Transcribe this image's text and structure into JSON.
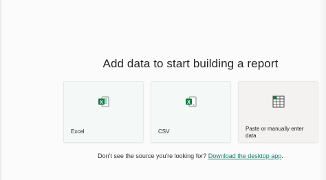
{
  "heading": "Add data to start building a report",
  "cards": [
    {
      "label": "Excel",
      "icon": "excel-icon"
    },
    {
      "label": "CSV",
      "icon": "csv-icon"
    },
    {
      "label": "Paste or manually enter data",
      "icon": "table-grid-icon"
    }
  ],
  "footer": {
    "prompt": "Don't see the source you're looking for?",
    "link": "Download the desktop app",
    "period": "."
  },
  "colors": {
    "excel_green": "#107c41",
    "link": "#117865"
  }
}
